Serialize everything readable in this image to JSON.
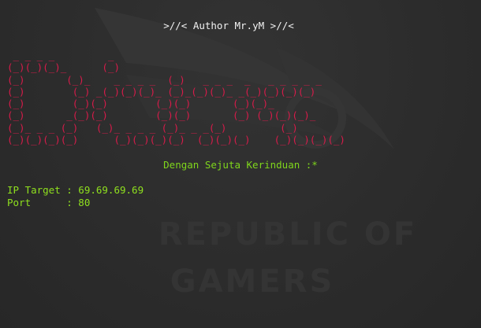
{
  "terminal": {
    "author_line": ">//< Author Mr.yM >//<",
    "banner_art": " _ _ _ _         _\n(_)(_)(_)_      (_)\n(_)       (_)_    _ _ _ _  (_)   _ _ _  _   _ _ _ _ _\n(_)        (_) _(_)(_)(_)_ (_)_(_)(_)_ _(_)(_)(_)(_)\n(_)        (_)(_)        (_)(_)       (_)(_)_\n(_)       _(_)(_)        (_)(_)       (_) (_)(_)(_)_\n(_)_ _ _ (_)   (_)_ _ _ _ (_)_ _ _(_)         (_)\n(_)(_)(_)(_)      (_)(_)(_)(_)  (_)(_)(_)    (_)(_)(_)(_)",
    "tagline": "Dengan Sejuta Kerinduan :*",
    "ip_line": "IP Target : 69.69.69.69",
    "port_line": "Port      : 80"
  },
  "wallpaper": {
    "watermark_line1": "REPUBLIC OF",
    "watermark_line2": "GAMERS",
    "logo_icon": "rog-eye-logo"
  },
  "colors": {
    "background": "#2e2e2e",
    "author_text": "#f2f2f2",
    "banner": "#d81b4a",
    "tagline": "#7fd61c",
    "info_text": "#8fe01e",
    "watermark": "#343434"
  }
}
